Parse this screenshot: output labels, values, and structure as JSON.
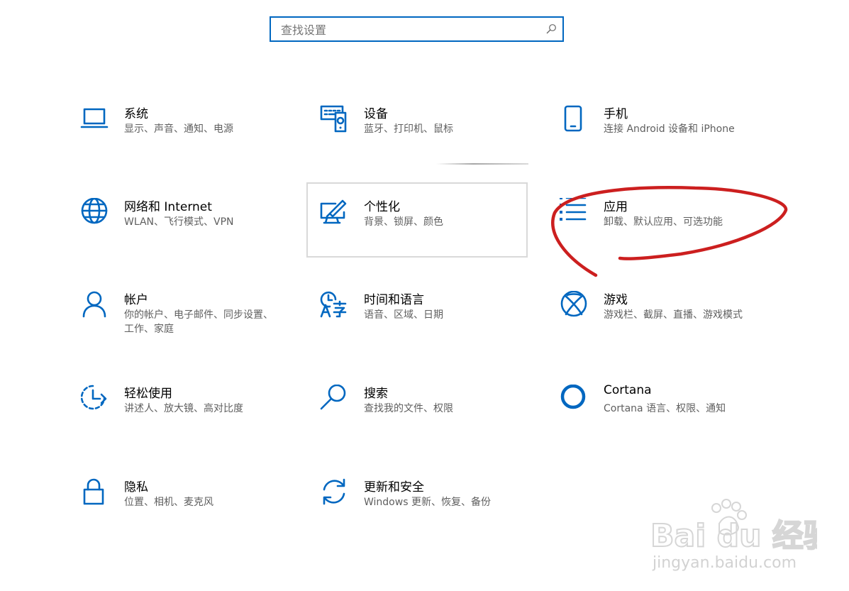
{
  "search": {
    "placeholder": "查找设置",
    "icon": "search-icon"
  },
  "tiles": [
    {
      "title": "系统",
      "desc": "显示、声音、通知、电源",
      "icon": "laptop-icon"
    },
    {
      "title": "设备",
      "desc": "蓝牙、打印机、鼠标",
      "icon": "devices-icon"
    },
    {
      "title": "手机",
      "desc": "连接 Android 设备和 iPhone",
      "icon": "phone-icon"
    },
    {
      "title": "网络和 Internet",
      "desc": "WLAN、飞行模式、VPN",
      "icon": "globe-icon"
    },
    {
      "title": "个性化",
      "desc": "背景、锁屏、颜色",
      "icon": "personalize-icon"
    },
    {
      "title": "应用",
      "desc": "卸载、默认应用、可选功能",
      "icon": "apps-list-icon"
    },
    {
      "title": "帐户",
      "desc": "你的帐户、电子邮件、同步设置、工作、家庭",
      "icon": "person-icon"
    },
    {
      "title": "时间和语言",
      "desc": "语音、区域、日期",
      "icon": "time-language-icon"
    },
    {
      "title": "游戏",
      "desc": "游戏栏、截屏、直播、游戏模式",
      "icon": "xbox-icon"
    },
    {
      "title": "轻松使用",
      "desc": "讲述人、放大镜、高对比度",
      "icon": "ease-of-access-icon"
    },
    {
      "title": "搜索",
      "desc": "查找我的文件、权限",
      "icon": "magnifier-icon"
    },
    {
      "title": "Cortana",
      "desc": "Cortana 语言、权限、通知",
      "icon": "cortana-icon"
    },
    {
      "title": "隐私",
      "desc": "位置、相机、麦克风",
      "icon": "lock-icon"
    },
    {
      "title": "更新和安全",
      "desc": "Windows 更新、恢复、备份",
      "icon": "update-icon"
    }
  ],
  "colors": {
    "accent": "#0067c0",
    "annotation": "#cc1f1f",
    "text": "#000000",
    "subtext": "#5f5f5f"
  },
  "watermark": {
    "brand": "Bai du 经验",
    "url": "jingyan.baidu.com"
  }
}
